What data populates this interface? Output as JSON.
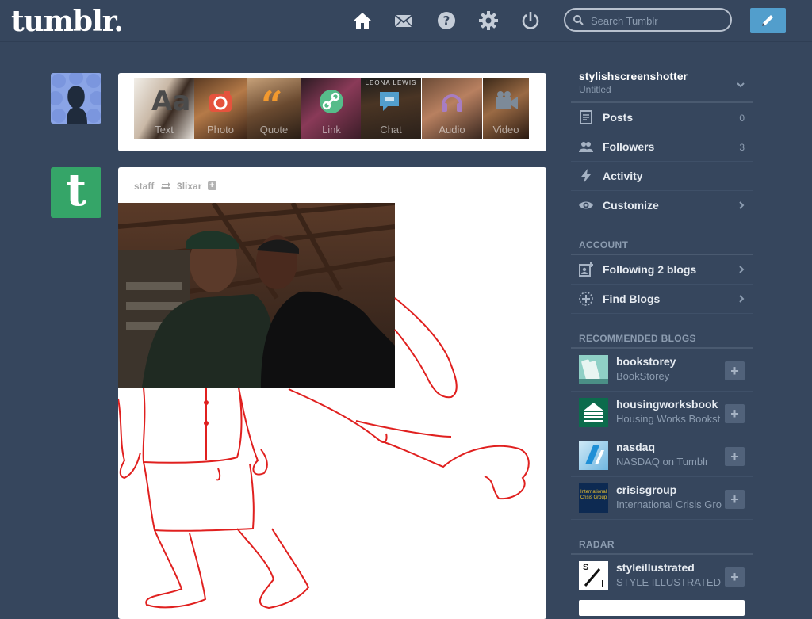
{
  "app": {
    "logo": "tumblr."
  },
  "search": {
    "placeholder": "Search Tumblr"
  },
  "post_form": {
    "items": [
      {
        "label": "Text"
      },
      {
        "label": "Photo"
      },
      {
        "label": "Quote"
      },
      {
        "label": "Link"
      },
      {
        "label": "Chat",
        "cover_text": "LEONA LEWIS"
      },
      {
        "label": "Audio"
      },
      {
        "label": "Video"
      }
    ]
  },
  "post": {
    "author": "staff",
    "reblogged_from": "3lixar",
    "follow_symbol": "+"
  },
  "sidebar": {
    "blog": {
      "name": "stylishscreenshotter",
      "subtitle": "Untitled"
    },
    "items": [
      {
        "label": "Posts",
        "count": "0"
      },
      {
        "label": "Followers",
        "count": "3"
      },
      {
        "label": "Activity"
      },
      {
        "label": "Customize"
      }
    ],
    "account_title": "ACCOUNT",
    "account_items": [
      {
        "label": "Following 2 blogs"
      },
      {
        "label": "Find Blogs"
      }
    ],
    "recommended_title": "RECOMMENDED BLOGS",
    "recommended": [
      {
        "name": "bookstorey",
        "title": "BookStorey"
      },
      {
        "name": "housingworksbook",
        "title": "Housing Works Bookst"
      },
      {
        "name": "nasdaq",
        "title": "NASDAQ on Tumblr"
      },
      {
        "name": "crisisgroup",
        "title": "International Crisis Gro",
        "avatar_text": "International Crisis Group"
      }
    ],
    "radar_title": "RADAR",
    "radar": {
      "name": "styleillustrated",
      "title": "STYLE ILLUSTRATED",
      "avatar_text": "S"
    },
    "follow_symbol": "+"
  },
  "colors": {
    "background": "#36465d",
    "accent": "#529ecc",
    "staff_green": "#35a568"
  }
}
